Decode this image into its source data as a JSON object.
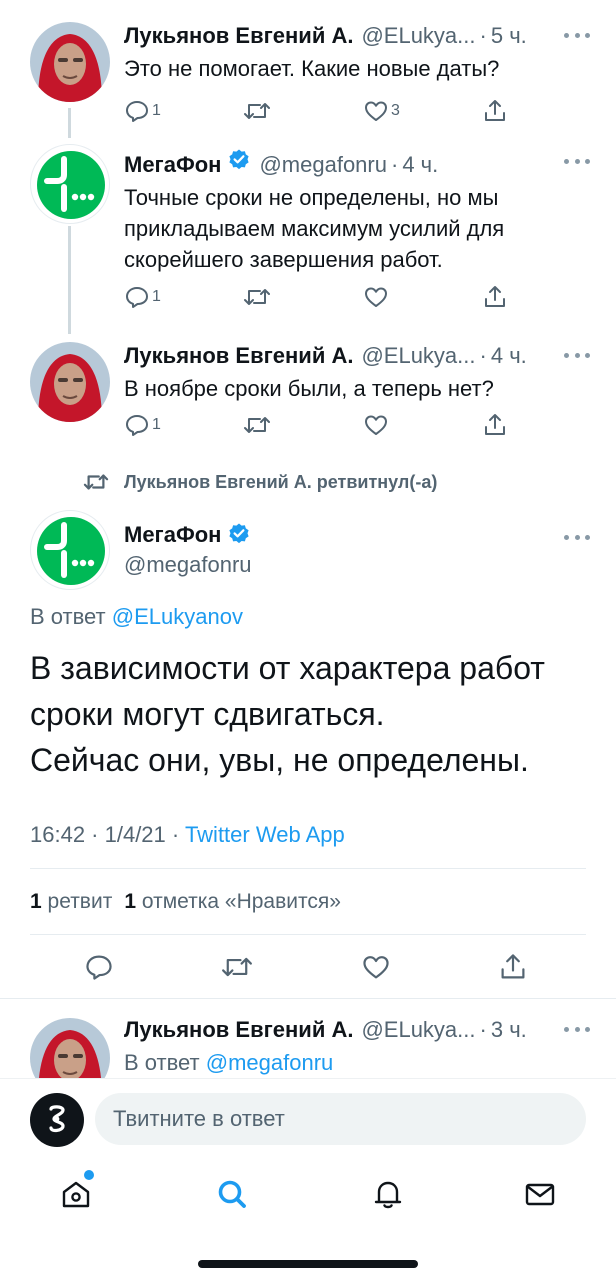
{
  "tweets": [
    {
      "name": "Лукьянов Евгений А.",
      "handle": "@ELukya...",
      "time": "5 ч.",
      "text": "Это не помогает. Какие новые даты?",
      "replies": "1",
      "likes": "3",
      "avatar": "user-photo"
    },
    {
      "name": "МегаФон",
      "handle": "@megafonru",
      "time": "4 ч.",
      "text": "Точные сроки не определены, но мы прикладываем максимум усилий для скорейшего завершения работ.",
      "replies": "1",
      "likes": "",
      "avatar": "megafon-logo",
      "verified": true
    },
    {
      "name": "Лукьянов Евгений А.",
      "handle": "@ELukya...",
      "time": "4 ч.",
      "text": "В ноябре сроки были, а теперь нет?",
      "replies": "1",
      "likes": "",
      "avatar": "user-photo"
    }
  ],
  "retweet_notice": "Лукьянов Евгений А. ретвитнул(-а)",
  "focus": {
    "name": "МегаФон",
    "handle": "@megafonru",
    "reply_prefix": "В ответ",
    "reply_mention": "@ELukyanov",
    "text_lines": [
      "В зависимости от характера работ",
      "сроки могут сдвигаться.",
      "Сейчас они, увы, не определены."
    ],
    "timestamp": "16:42 · 1/4/21 · ",
    "app": "Twitter Web App",
    "retweets_count": "1",
    "retweets_label": "ретвит",
    "likes_count": "1",
    "likes_label": "отметка «Нравится»"
  },
  "next_tweet": {
    "name": "Лукьянов Евгений А.",
    "handle": "@ELukya...",
    "time": "3 ч.",
    "reply_prefix": "В ответ",
    "reply_mention": "@megafonru"
  },
  "composer": {
    "placeholder": "Твитните в ответ"
  },
  "tabs": [
    "home-icon",
    "search-icon",
    "notifications-icon",
    "messages-icon"
  ],
  "colors": {
    "accent": "#1d9bf0",
    "megafon_green": "#00b956",
    "secondary_text": "#536471"
  }
}
